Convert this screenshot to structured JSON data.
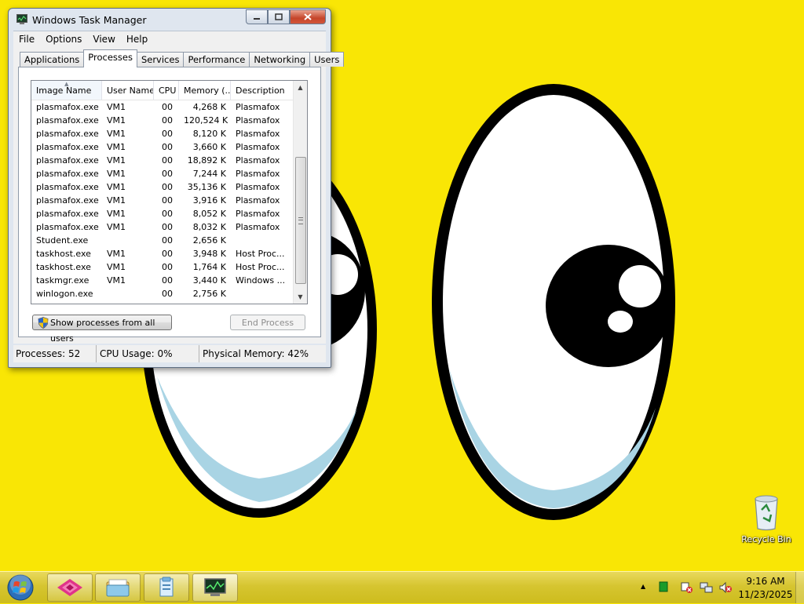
{
  "window": {
    "title": "Windows Task Manager"
  },
  "menu": [
    "File",
    "Options",
    "View",
    "Help"
  ],
  "tabs": [
    {
      "label": "Applications",
      "active": false
    },
    {
      "label": "Processes",
      "active": true
    },
    {
      "label": "Services",
      "active": false
    },
    {
      "label": "Performance",
      "active": false
    },
    {
      "label": "Networking",
      "active": false
    },
    {
      "label": "Users",
      "active": false
    }
  ],
  "processes": {
    "columns": [
      "Image Name",
      "User Name",
      "CPU",
      "Memory (...",
      "Description"
    ],
    "sorted_column": "Image Name",
    "rows": [
      [
        "plasmafox.exe",
        "VM1",
        "00",
        "4,268 K",
        "Plasmafox"
      ],
      [
        "plasmafox.exe",
        "VM1",
        "00",
        "120,524 K",
        "Plasmafox"
      ],
      [
        "plasmafox.exe",
        "VM1",
        "00",
        "8,120 K",
        "Plasmafox"
      ],
      [
        "plasmafox.exe",
        "VM1",
        "00",
        "3,660 K",
        "Plasmafox"
      ],
      [
        "plasmafox.exe",
        "VM1",
        "00",
        "18,892 K",
        "Plasmafox"
      ],
      [
        "plasmafox.exe",
        "VM1",
        "00",
        "7,244 K",
        "Plasmafox"
      ],
      [
        "plasmafox.exe",
        "VM1",
        "00",
        "35,136 K",
        "Plasmafox"
      ],
      [
        "plasmafox.exe",
        "VM1",
        "00",
        "3,916 K",
        "Plasmafox"
      ],
      [
        "plasmafox.exe",
        "VM1",
        "00",
        "8,052 K",
        "Plasmafox"
      ],
      [
        "plasmafox.exe",
        "VM1",
        "00",
        "8,032 K",
        "Plasmafox"
      ],
      [
        "Student.exe",
        "",
        "00",
        "2,656 K",
        ""
      ],
      [
        "taskhost.exe",
        "VM1",
        "00",
        "3,948 K",
        "Host Proc..."
      ],
      [
        "taskhost.exe",
        "VM1",
        "00",
        "1,764 K",
        "Host Proc..."
      ],
      [
        "taskmgr.exe",
        "VM1",
        "00",
        "3,440 K",
        "Windows ..."
      ],
      [
        "winlogon.exe",
        "",
        "00",
        "2,756 K",
        ""
      ]
    ]
  },
  "buttons": {
    "show_all": "Show processes from all users",
    "end_process": "End Process"
  },
  "status": {
    "processes": "Processes: 52",
    "cpu": "CPU Usage: 0%",
    "memory": "Physical Memory: 42%"
  },
  "desktop": {
    "recycle_bin": "Recycle Bin"
  },
  "taskbar": {
    "time": "9:16 AM",
    "date": "11/23/2025",
    "pinned": [
      "plasmafox-icon",
      "explorer-folder-icon",
      "student-app-icon",
      "task-manager-icon"
    ]
  },
  "colors": {
    "wallpaper": "#f9e605",
    "taskbar": "#d6c530"
  }
}
